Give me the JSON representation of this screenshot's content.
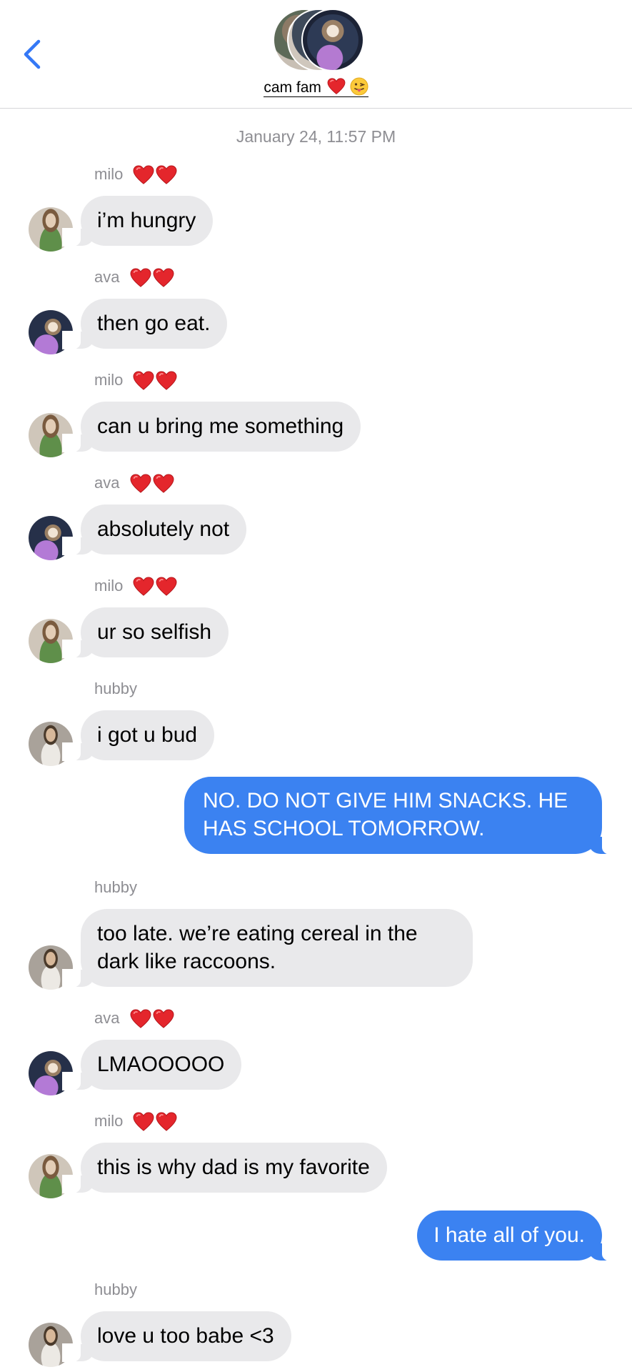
{
  "header": {
    "group_name": "cam fam",
    "group_emoji": [
      "red-heart-emoji",
      "tongue-face-emoji"
    ],
    "back_icon": "chevron-left-icon"
  },
  "conversation": {
    "timestamp": "January 24, 11:57 PM",
    "messages": [
      {
        "sender": "milo",
        "sender_hearts": 2,
        "text": "i’m hungry",
        "direction": "incoming"
      },
      {
        "sender": "ava",
        "sender_hearts": 2,
        "text": "then go eat.",
        "direction": "incoming"
      },
      {
        "sender": "milo",
        "sender_hearts": 2,
        "text": "can u bring me something",
        "direction": "incoming"
      },
      {
        "sender": "ava",
        "sender_hearts": 2,
        "text": "absolutely not",
        "direction": "incoming"
      },
      {
        "sender": "milo",
        "sender_hearts": 2,
        "text": "ur so selfish",
        "direction": "incoming"
      },
      {
        "sender": "hubby",
        "sender_hearts": 0,
        "text": "i got u bud",
        "direction": "incoming"
      },
      {
        "sender": "",
        "text": "NO. DO NOT GIVE HIM SNACKS. HE HAS SCHOOL TOMORROW.",
        "direction": "outgoing"
      },
      {
        "sender": "hubby",
        "sender_hearts": 0,
        "text": "too late. we’re eating cereal in the dark like raccoons.",
        "direction": "incoming"
      },
      {
        "sender": "ava",
        "sender_hearts": 2,
        "text": "LMAOOOOO",
        "direction": "incoming"
      },
      {
        "sender": "milo",
        "sender_hearts": 2,
        "text": "this is why dad is my favorite",
        "direction": "incoming"
      },
      {
        "sender": "",
        "text": "I hate all of you.",
        "direction": "outgoing"
      },
      {
        "sender": "hubby",
        "sender_hearts": 0,
        "text": "love u too babe <3",
        "direction": "incoming"
      }
    ]
  },
  "colors": {
    "outgoing_bubble": "#3b82f1",
    "incoming_bubble": "#e9e9eb",
    "accent_blue": "#3478f6",
    "meta_gray": "#8e8e93"
  }
}
